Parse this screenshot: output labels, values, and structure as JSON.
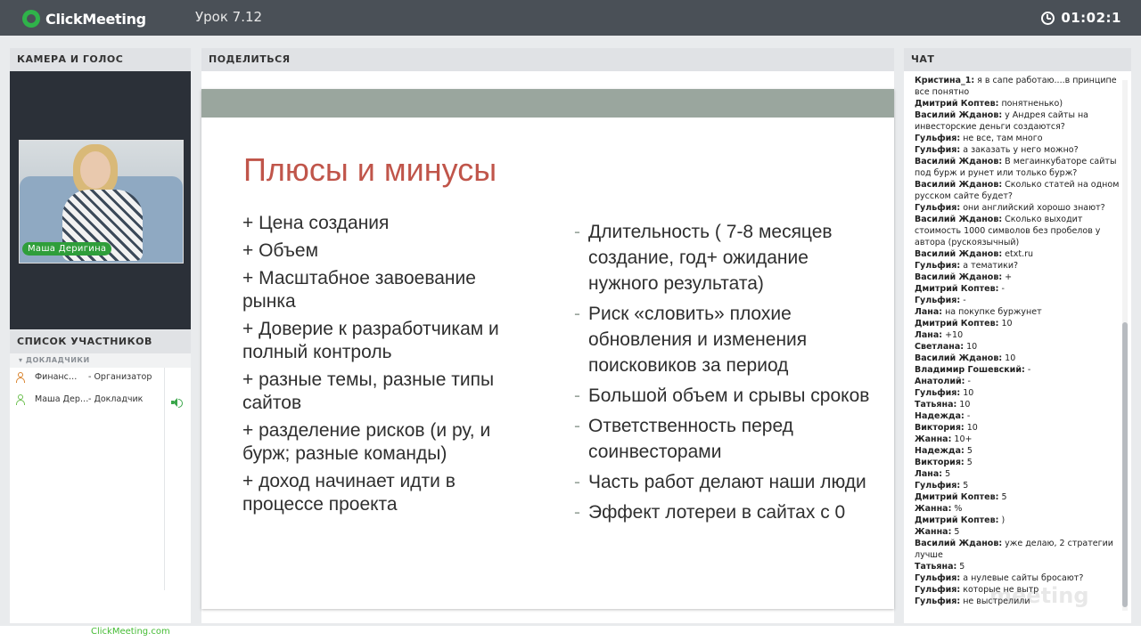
{
  "app": {
    "logo_text": "ClickMeeting",
    "lesson_title": "Урок 7.12",
    "timer": "01:02:1"
  },
  "camera": {
    "header": "КАМЕРА И ГОЛОС",
    "name_tag": "Маша Деригина"
  },
  "participants": {
    "header": "СПИСОК УЧАСТНИКОВ",
    "group": "ДОКЛАДЧИКИ",
    "rows": [
      {
        "name": "Финанс…",
        "role": "- Организатор",
        "icon_color": "#d9822b"
      },
      {
        "name": "Маша Дер…",
        "role": "- Докладчик",
        "icon_color": "#6bbf4e"
      }
    ]
  },
  "share": {
    "header": "ПОДЕЛИТЬСЯ",
    "slide_title": "Плюсы и минусы",
    "pros": [
      "+ Цена создания",
      "+ Объем",
      "+ Масштабное завоевание рынка",
      "+ Доверие к разработчикам и полный контроль",
      "+ разные темы, разные типы сайтов",
      "+ разделение рисков (и ру, и бурж; разные команды)",
      "+ доход начинает идти в процессе проекта"
    ],
    "cons": [
      "Длительность ( 7-8 месяцев создание, год+ ожидание нужного результата)",
      "Риск «словить» плохие обновления и изменения поисковиков за период",
      "Большой объем и срывы сроков",
      "Ответственность перед соинвесторами",
      "Часть работ делают наши люди",
      "Эффект лотереи в сайтах с 0"
    ]
  },
  "chat": {
    "header": "ЧАТ",
    "messages": [
      {
        "author": "Кристина_1:",
        "text": "я в сапе работаю....в принципе все понятно"
      },
      {
        "author": "Дмитрий Коптев:",
        "text": "понятненько)"
      },
      {
        "author": "Василий Жданов:",
        "text": "у Андрея сайты на инвесторские деньги создаются?"
      },
      {
        "author": "Гульфия:",
        "text": "не все, там много"
      },
      {
        "author": "Гульфия:",
        "text": "а заказать у него можно?"
      },
      {
        "author": "Василий Жданов:",
        "text": "В мегаинкубаторе сайты под бурж и рунет или только бурж?"
      },
      {
        "author": "Василий Жданов:",
        "text": "Сколько статей на одном русском сайте будет?"
      },
      {
        "author": "Гульфия:",
        "text": "они английский хорошо знают?"
      },
      {
        "author": "Василий Жданов:",
        "text": "Сколько выходит стоимость 1000 символов без пробелов у автора (рускоязычный)"
      },
      {
        "author": "Василий Жданов:",
        "text": "etxt.ru"
      },
      {
        "author": "Гульфия:",
        "text": "а тематики?"
      },
      {
        "author": "Василий Жданов:",
        "text": "+"
      },
      {
        "author": "Дмитрий Коптев:",
        "text": "-"
      },
      {
        "author": "Гульфия:",
        "text": "-"
      },
      {
        "author": "Лана:",
        "text": "на покупке буржунет"
      },
      {
        "author": "Дмитрий Коптев:",
        "text": "10"
      },
      {
        "author": "Лана:",
        "text": "+10"
      },
      {
        "author": "Светлана:",
        "text": "10"
      },
      {
        "author": "Василий Жданов:",
        "text": "10"
      },
      {
        "author": "Владимир Гошевский:",
        "text": "-"
      },
      {
        "author": "Анатолий:",
        "text": "-"
      },
      {
        "author": "Гульфия:",
        "text": "10"
      },
      {
        "author": "Татьяна:",
        "text": "10"
      },
      {
        "author": "Надежда:",
        "text": "-"
      },
      {
        "author": "Виктория:",
        "text": "10"
      },
      {
        "author": "Жанна:",
        "text": "10+"
      },
      {
        "author": "Надежда:",
        "text": "5"
      },
      {
        "author": "Виктория:",
        "text": "5"
      },
      {
        "author": "Лана:",
        "text": "5"
      },
      {
        "author": "Гульфия:",
        "text": "5"
      },
      {
        "author": "Дмитрий Коптев:",
        "text": "5"
      },
      {
        "author": "Жанна:",
        "text": "%"
      },
      {
        "author": "Дмитрий Коптев:",
        "text": ")"
      },
      {
        "author": "Жанна:",
        "text": "5"
      },
      {
        "author": "Василий Жданов:",
        "text": "уже делаю, 2 стратегии лучше"
      },
      {
        "author": "Татьяна:",
        "text": "5"
      },
      {
        "author": "Гульфия:",
        "text": "а нулевые сайты бросают?"
      },
      {
        "author": "Гульфия:",
        "text": "которые не вытр"
      },
      {
        "author": "Гульфия:",
        "text": "не выстрелили"
      }
    ],
    "watermark": "meeting"
  },
  "footer": {
    "link": "ClickMeeting.com"
  }
}
